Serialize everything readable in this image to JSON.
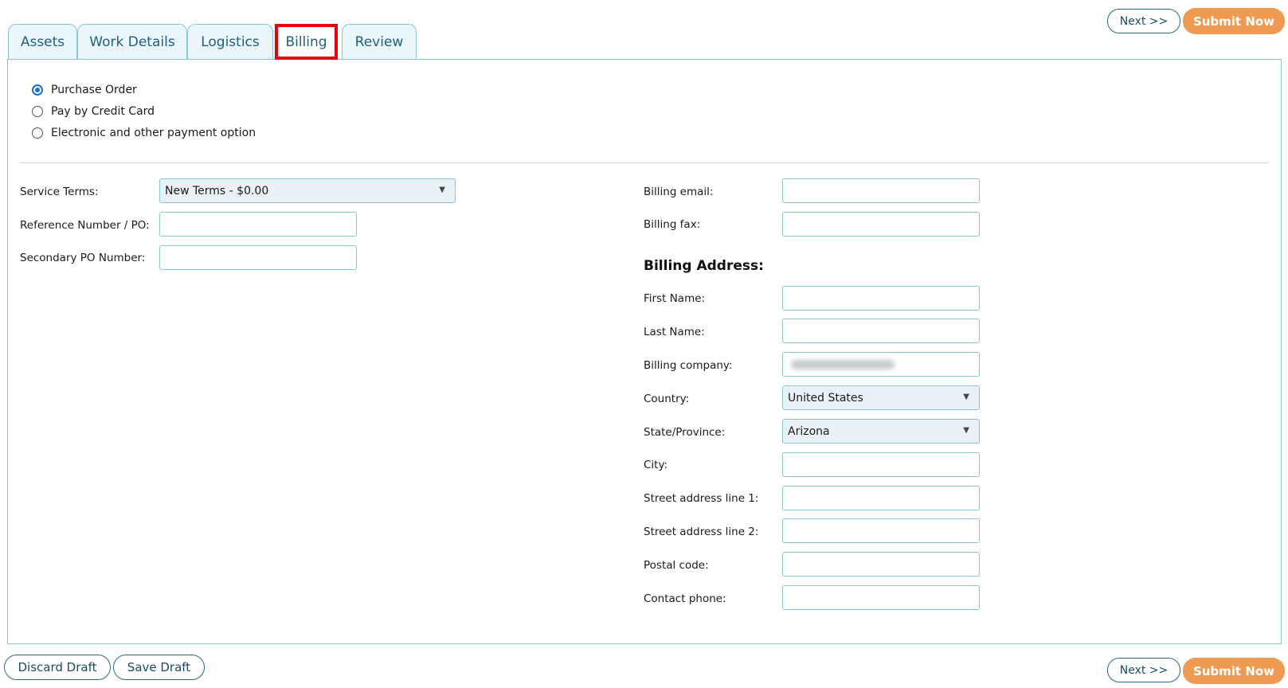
{
  "actions": {
    "next_label": "Next >>",
    "submit_label": "Submit Now",
    "discard_label": "Discard Draft",
    "save_label": "Save Draft"
  },
  "tabs": [
    {
      "label": "Assets"
    },
    {
      "label": "Work Details"
    },
    {
      "label": "Logistics"
    },
    {
      "label": "Billing",
      "active": true
    },
    {
      "label": "Review"
    }
  ],
  "payment_options": [
    {
      "label": "Purchase Order",
      "selected": true
    },
    {
      "label": "Pay by Credit Card",
      "selected": false
    },
    {
      "label": "Electronic and other payment option",
      "selected": false
    }
  ],
  "left_form": {
    "service_terms_label": "Service Terms:",
    "service_terms_value": "New Terms - $0.00",
    "reference_label": "Reference Number / PO:",
    "reference_value": "",
    "secondary_po_label": "Secondary PO Number:",
    "secondary_po_value": ""
  },
  "right_form": {
    "billing_email_label": "Billing email:",
    "billing_fax_label": "Billing fax:",
    "billing_address_title": "Billing Address:",
    "first_name_label": "First Name:",
    "last_name_label": "Last Name:",
    "billing_company_label": "Billing company:",
    "country_label": "Country:",
    "country_value": "United States",
    "state_label": "State/Province:",
    "state_value": "Arizona",
    "city_label": "City:",
    "street1_label": "Street address line 1:",
    "street2_label": "Street address line 2:",
    "postal_label": "Postal code:",
    "phone_label": "Contact phone:"
  },
  "colors": {
    "accent": "#2a6a8a",
    "submit": "#ee9a52",
    "tab_border": "#8cc4d8",
    "active_highlight": "#e8000b",
    "radio_selected": "#1a6fd6"
  }
}
